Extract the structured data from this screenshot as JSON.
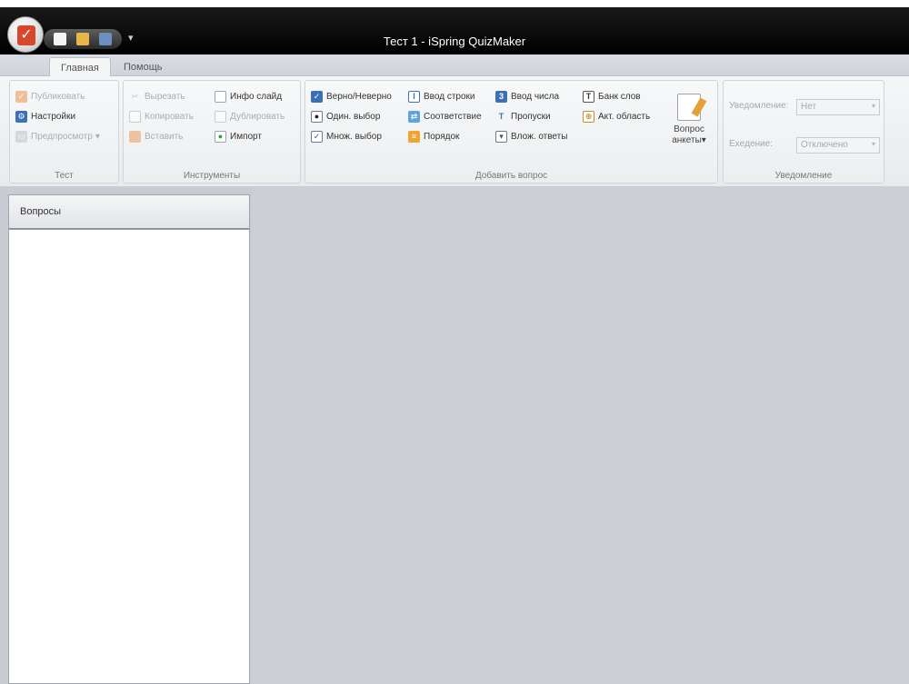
{
  "window": {
    "title": "Тест 1 - iSpring QuizMaker"
  },
  "qat": {
    "more": "▾"
  },
  "tabs": [
    {
      "label": "Главная",
      "active": true
    },
    {
      "label": "Помощь",
      "active": false
    }
  ],
  "ribbon": {
    "test": {
      "label": "Тест",
      "publish": "Публиковать",
      "settings": "Настройки",
      "preview": "Предпросмотр"
    },
    "tools": {
      "label": "Инструменты",
      "cut": "Вырезать",
      "copy": "Копировать",
      "paste": "Вставить",
      "info_slide": "Инфо слайд",
      "duplicate": "Дублировать",
      "import": "Импорт"
    },
    "add_question": {
      "label": "Добавить вопрос",
      "true_false": "Верно/Неверно",
      "single_choice": "Один. выбор",
      "multiple_choice": "Множ. выбор",
      "short_answer": "Ввод строки",
      "matching": "Соответствие",
      "sequence": "Порядок",
      "numeric": "Ввод числа",
      "fill_blanks": "Пропуски",
      "multiple_dropdowns": "Влож. ответы",
      "word_bank": "Банк слов",
      "hotspot": "Акт. область",
      "survey_question_line1": "Вопрос",
      "survey_question_line2": "анкеты"
    },
    "notifications": {
      "label": "Уведомление",
      "notify_label": "Уведомление:",
      "notify_value": "Нет",
      "execution_label": "Exeдение:",
      "execution_value": "Отключено"
    }
  },
  "sidebar": {
    "title": "Вопросы"
  }
}
